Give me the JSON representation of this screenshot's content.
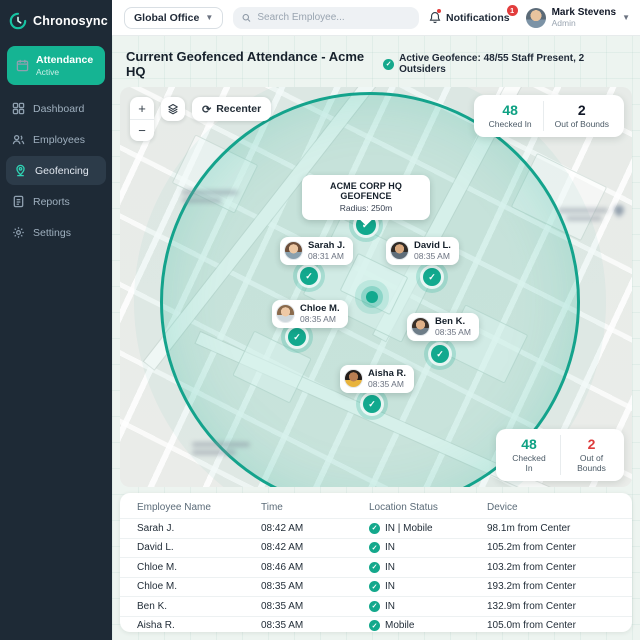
{
  "colors": {
    "accent": "#15b493",
    "accent_dark": "#12a98e",
    "danger": "#e23d3d",
    "sidebar_bg": "#1e2a36"
  },
  "brand": {
    "name": "Chronosync"
  },
  "topbar": {
    "office_selector": "Global Office",
    "search_placeholder": "Search Employee...",
    "notifications_label": "Notifications",
    "notifications_count": "1",
    "user": {
      "name": "Mark Stevens",
      "role": "Admin"
    }
  },
  "sidebar": {
    "items": [
      {
        "label": "Attendance",
        "sublabel": "Active"
      },
      {
        "label": "Dashboard"
      },
      {
        "label": "Employees"
      },
      {
        "label": "Geofencing"
      },
      {
        "label": "Reports"
      },
      {
        "label": "Settings"
      }
    ]
  },
  "header": {
    "title": "Current Geofenced Attendance - Acme HQ",
    "status": "Active Geofence: 48/55 Staff Present, 2 Outsiders"
  },
  "map": {
    "controls": {
      "zoom_in": "+",
      "zoom_out": "−",
      "recenter": "Recenter"
    },
    "geofence": {
      "title": "ACME CORP HQ GEOFENCE",
      "radius_label": "Radius: 250m"
    },
    "pins": [
      {
        "name": "Sarah J.",
        "time": "08:31 AM"
      },
      {
        "name": "David L.",
        "time": "08:35 AM"
      },
      {
        "name": "Chloe M.",
        "time": "08:35 AM"
      },
      {
        "name": "Ben K.",
        "time": "08:35 AM"
      },
      {
        "name": "Aisha R.",
        "time": "08:35 AM"
      }
    ]
  },
  "stats_top": {
    "checked_in_value": "48",
    "checked_in_label": "Checked In",
    "out_of_bounds_value": "2",
    "out_of_bounds_label": "Out of Bounds"
  },
  "stats_bottom": {
    "checked_in_value": "48",
    "checked_in_label": "Checked In",
    "out_of_bounds_value": "2",
    "out_of_bounds_label": "Out of Bounds"
  },
  "table": {
    "headers": [
      "Employee Name",
      "Time",
      "Location Status",
      "Device"
    ],
    "rows": [
      {
        "name": "Sarah J.",
        "time": "08:42 AM",
        "status": "IN | Mobile",
        "device": "98.1m from Center"
      },
      {
        "name": "David L.",
        "time": "08:42 AM",
        "status": "IN",
        "device": "105.2m from Center"
      },
      {
        "name": "Chloe M.",
        "time": "08:46 AM",
        "status": "IN",
        "device": "103.2m from Center"
      },
      {
        "name": "Chloe M.",
        "time": "08:35 AM",
        "status": "IN",
        "device": "193.2m from Center"
      },
      {
        "name": "Ben K.",
        "time": "08:35 AM",
        "status": "IN",
        "device": "132.9m from Center"
      },
      {
        "name": "Aisha R.",
        "time": "08:35 AM",
        "status": "Mobile",
        "device": "105.0m from Center"
      }
    ]
  }
}
